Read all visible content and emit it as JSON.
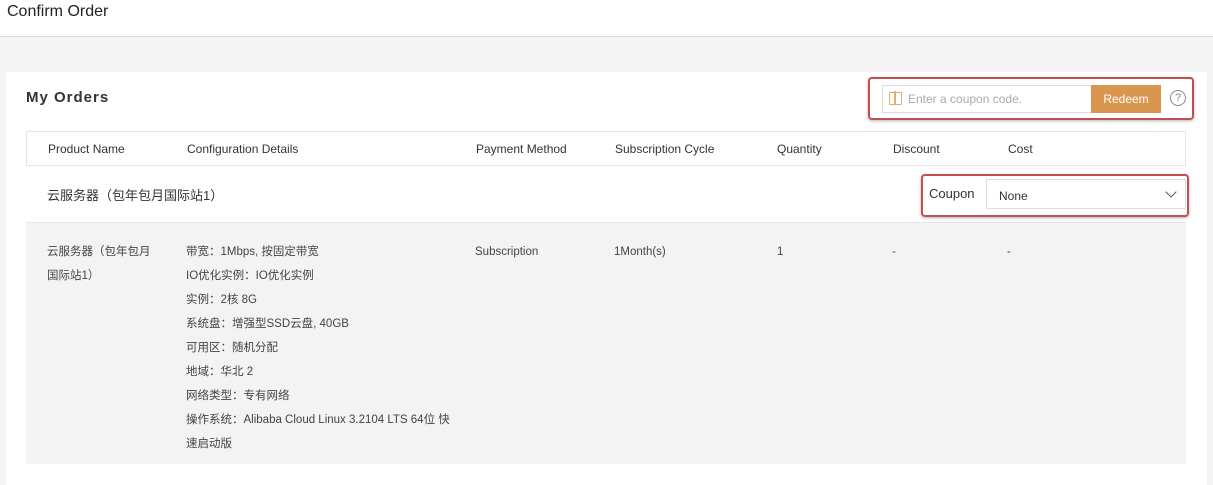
{
  "page_title": "Confirm Order",
  "card_title": "My Orders",
  "coupon": {
    "placeholder": "Enter a coupon code.",
    "redeem_label": "Redeem",
    "help": "?"
  },
  "columns": [
    "Product Name",
    "Configuration Details",
    "Payment Method",
    "Subscription Cycle",
    "Quantity",
    "Discount",
    "Cost"
  ],
  "group": {
    "name": "云服务器（包年包月国际站1）",
    "coupon_label": "Coupon",
    "coupon_value": "None"
  },
  "row": {
    "product": [
      "云服务器（包年包月",
      "国际站1）"
    ],
    "config": [
      "带宽：1Mbps, 按固定带宽",
      "IO优化实例：IO优化实例",
      "实例：2核 8G",
      "系统盘：增强型SSD云盘, 40GB",
      "可用区：随机分配",
      "地域：华北 2",
      "网络类型：专有网络",
      "操作系统：Alibaba Cloud Linux 3.2104 LTS 64位 快",
      "速启动版"
    ],
    "payment": "Subscription",
    "cycle": "1Month(s)",
    "quantity": "1",
    "discount": "-",
    "cost": "-"
  },
  "colors": {
    "accent": "#d9964f",
    "highlight": "#c0504d"
  }
}
